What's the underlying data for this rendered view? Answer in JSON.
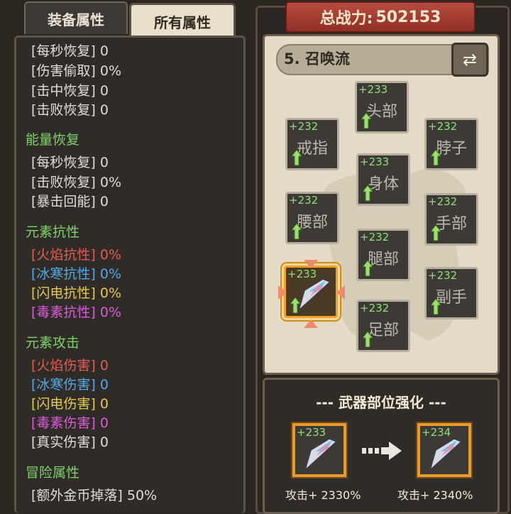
{
  "tabs": {
    "equipment": "装备属性",
    "all": "所有属性"
  },
  "stats": [
    {
      "text": "[每秒恢复] 0",
      "type": "item"
    },
    {
      "text": "[伤害偷取] 0%",
      "type": "item"
    },
    {
      "text": "[击中恢复] 0",
      "type": "item"
    },
    {
      "text": "[击败恢复] 0",
      "type": "item"
    },
    {
      "text": "能量恢复",
      "type": "head"
    },
    {
      "text": "[每秒恢复] 0",
      "type": "item"
    },
    {
      "text": "[击败恢复] 0%",
      "type": "item"
    },
    {
      "text": "[暴击回能] 0",
      "type": "item"
    },
    {
      "text": "元素抗性",
      "type": "head"
    },
    {
      "text": "[火焰抗性] 0%",
      "type": "fire"
    },
    {
      "text": "[冰寒抗性] 0%",
      "type": "ice"
    },
    {
      "text": "[闪电抗性] 0%",
      "type": "bolt"
    },
    {
      "text": "[毒素抗性] 0%",
      "type": "poison"
    },
    {
      "text": "元素攻击",
      "type": "head"
    },
    {
      "text": "[火焰伤害] 0",
      "type": "fire"
    },
    {
      "text": "[冰寒伤害] 0",
      "type": "ice"
    },
    {
      "text": "[闪电伤害] 0",
      "type": "bolt"
    },
    {
      "text": "[毒素伤害] 0",
      "type": "poison"
    },
    {
      "text": "[真实伤害] 0",
      "type": "item"
    },
    {
      "text": "冒险属性",
      "type": "head"
    },
    {
      "text": "[额外金币掉落] 50%",
      "type": "item"
    }
  ],
  "power": {
    "label": "总战力:",
    "value": "502153"
  },
  "loadout": {
    "title": "5. 召唤流"
  },
  "slots": {
    "head": {
      "level": "+233",
      "name": "头部"
    },
    "ring": {
      "level": "+232",
      "name": "戒指"
    },
    "neck": {
      "level": "+232",
      "name": "脖子"
    },
    "body": {
      "level": "+233",
      "name": "身体"
    },
    "waist": {
      "level": "+232",
      "name": "腰部"
    },
    "hand": {
      "level": "+232",
      "name": "手部"
    },
    "leg": {
      "level": "+232",
      "name": "腿部"
    },
    "weapon": {
      "level": "+233",
      "name": ""
    },
    "offhand": {
      "level": "+232",
      "name": "副手"
    },
    "foot": {
      "level": "+232",
      "name": "足部"
    }
  },
  "upgrade": {
    "title": "--- 武器部位强化 ---",
    "current_level": "+233",
    "next_level": "+234",
    "current_attack": "攻击+ 2330%",
    "next_attack": "攻击+ 2340%"
  },
  "colors": {
    "heading": "#7fd06a",
    "fire": "#e35b54",
    "ice": "#55a7e6",
    "bolt": "#e6c94d",
    "poison": "#d95bd9",
    "level": "#8ee07a",
    "selected_border": "#f0a126"
  }
}
